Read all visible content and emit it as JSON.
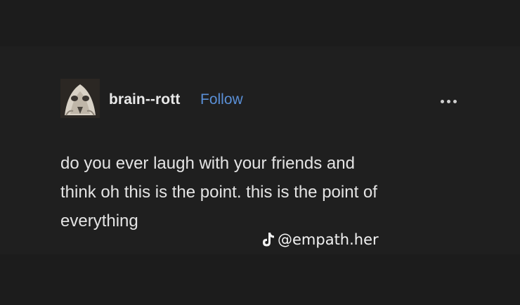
{
  "post": {
    "username": "brain--rott",
    "follow_label": "Follow",
    "more_label": "•••",
    "body_lines": [
      "do you ever laugh with your friends and",
      "think oh this is the point. this is the point of",
      "everything"
    ]
  },
  "watermark": {
    "handle": "@empath.her",
    "icon": "tiktok-icon"
  },
  "colors": {
    "background": "#1b1b1b",
    "card": "#1f1f1f",
    "text": "#e4e4e4",
    "link": "#5a8fd6"
  }
}
